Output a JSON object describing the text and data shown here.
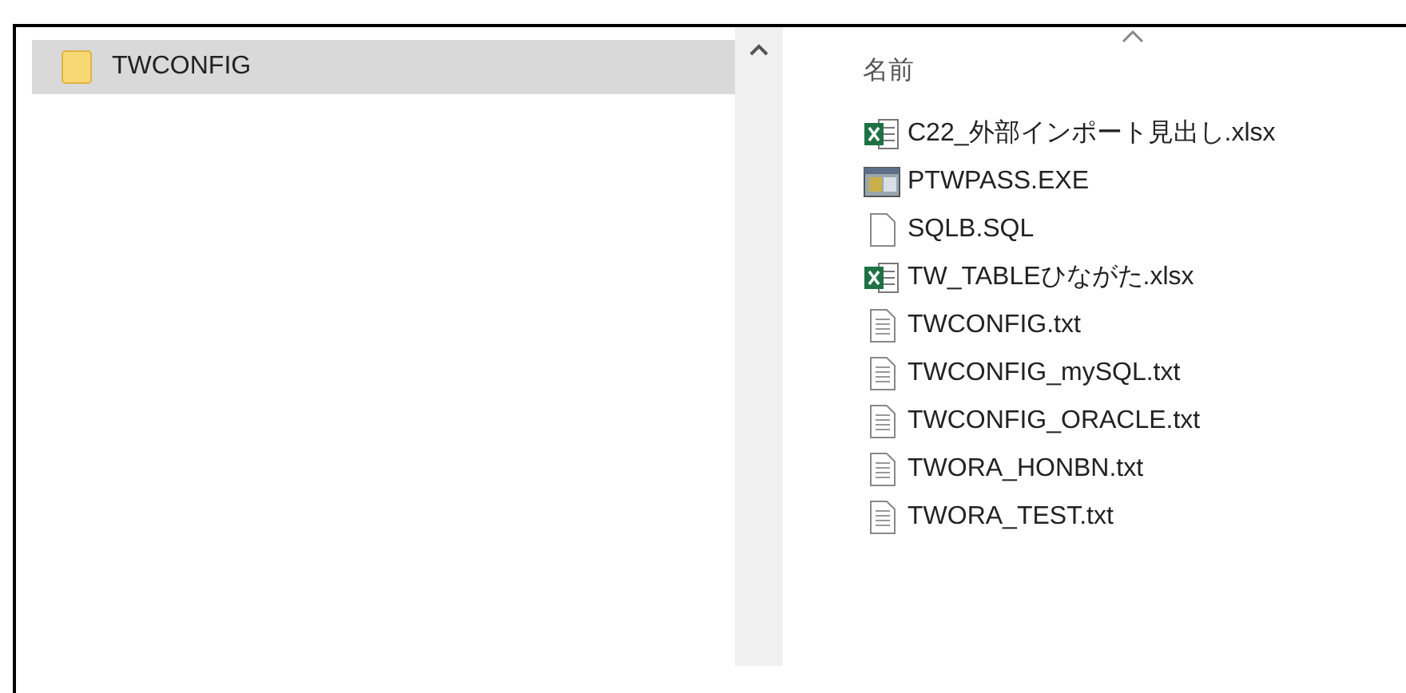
{
  "tree": {
    "items": [
      {
        "label": "TWCONFIG",
        "selected": true
      }
    ]
  },
  "list": {
    "column": "名前",
    "files": [
      {
        "name": "C22_外部インポート見出し.xlsx",
        "kind": "excel"
      },
      {
        "name": "PTWPASS.EXE",
        "kind": "exe"
      },
      {
        "name": "SQLB.SQL",
        "kind": "blank"
      },
      {
        "name": "TW_TABLEひながた.xlsx",
        "kind": "excel"
      },
      {
        "name": "TWCONFIG.txt",
        "kind": "text"
      },
      {
        "name": "TWCONFIG_mySQL.txt",
        "kind": "text"
      },
      {
        "name": "TWCONFIG_ORACLE.txt",
        "kind": "text"
      },
      {
        "name": "TWORA_HONBN.txt",
        "kind": "text"
      },
      {
        "name": "TWORA_TEST.txt",
        "kind": "text"
      }
    ]
  }
}
